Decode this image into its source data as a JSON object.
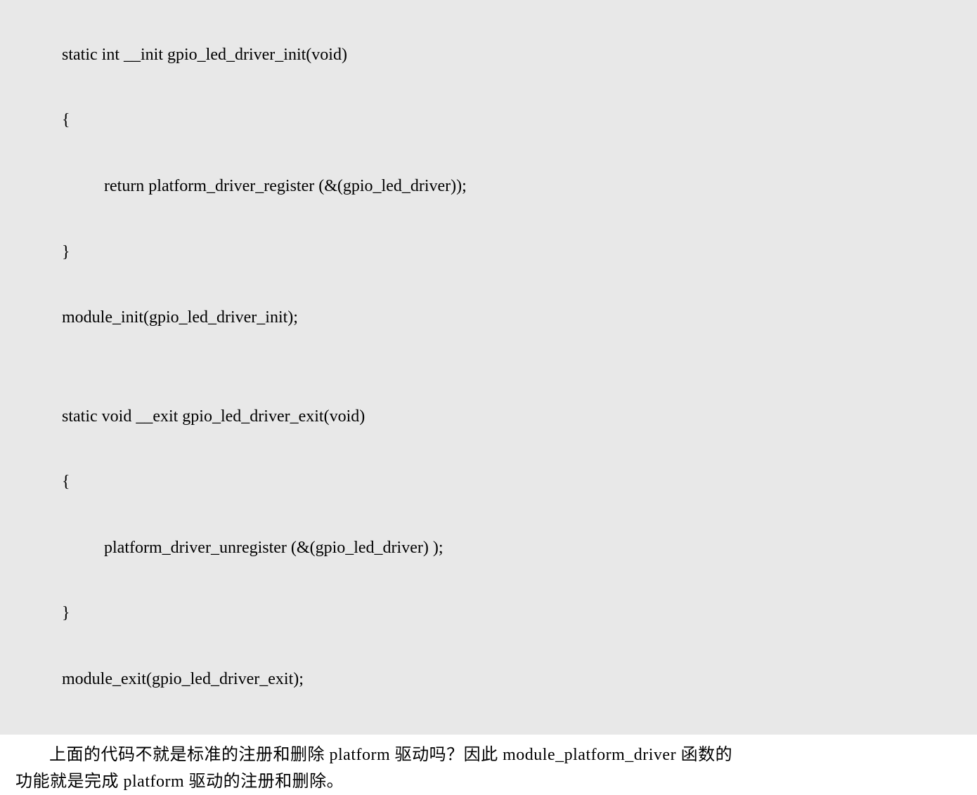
{
  "code": {
    "line1": "static int __init gpio_led_driver_init(void)",
    "line2": "{",
    "line3": "return platform_driver_register (&(gpio_led_driver));",
    "line4": "}",
    "line5": "module_init(gpio_led_driver_init);",
    "line6": "",
    "line7": "static void __exit gpio_led_driver_exit(void)",
    "line8": "{",
    "line9": "platform_driver_unregister (&(gpio_led_driver) );",
    "line10": "}",
    "line11": "module_exit(gpio_led_driver_exit);"
  },
  "prose": {
    "paragraph_line1": "上面的代码不就是标准的注册和删除 platform 驱动吗？因此 module_platform_driver 函数的",
    "paragraph_line2": "功能就是完成 platform 驱动的注册和删除。"
  }
}
